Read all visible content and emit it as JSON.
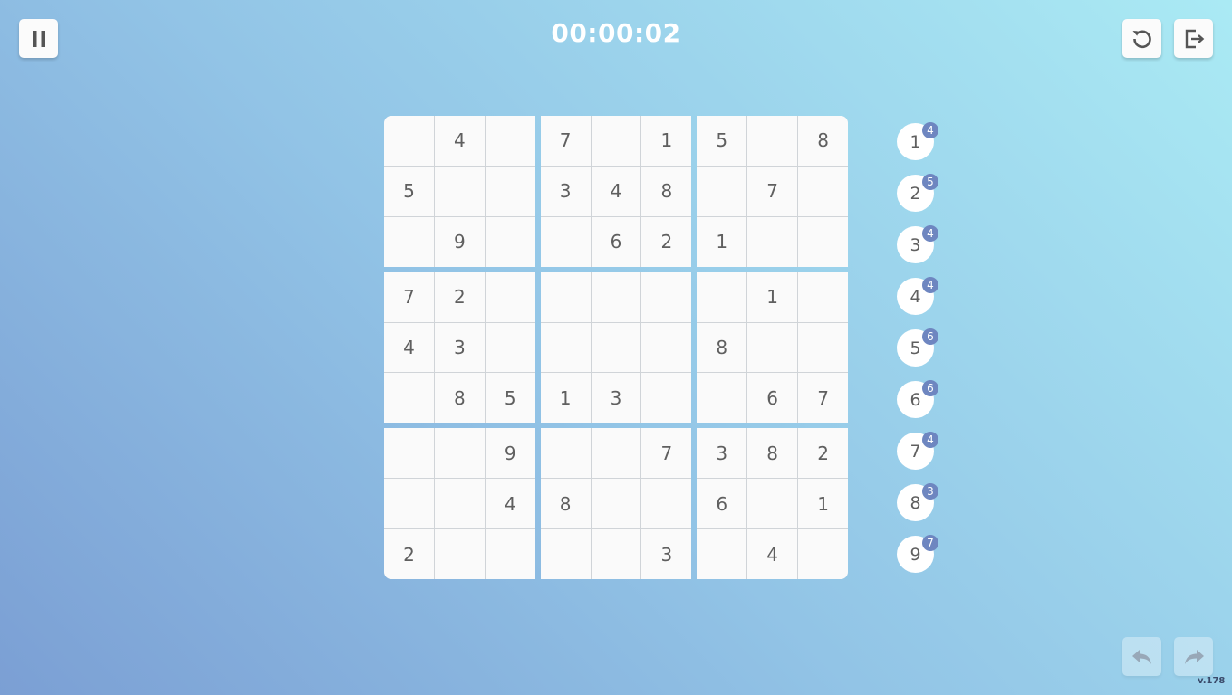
{
  "timer": "00:00:02",
  "toolbar": {
    "pause_icon": "pause-icon",
    "restart_icon": "restart-icon",
    "exit_icon": "exit-icon",
    "undo_icon": "undo-icon",
    "redo_icon": "redo-icon"
  },
  "board": [
    [
      "",
      "4",
      "",
      "7",
      "",
      "1",
      "5",
      "",
      "8"
    ],
    [
      "5",
      "",
      "",
      "3",
      "4",
      "8",
      "",
      "7",
      ""
    ],
    [
      "",
      "9",
      "",
      "",
      "6",
      "2",
      "1",
      "",
      ""
    ],
    [
      "7",
      "2",
      "",
      "",
      "",
      "",
      "",
      "1",
      ""
    ],
    [
      "4",
      "3",
      "",
      "",
      "",
      "",
      "8",
      "",
      ""
    ],
    [
      "",
      "8",
      "5",
      "1",
      "3",
      "",
      "",
      "6",
      "7"
    ],
    [
      "",
      "",
      "9",
      "",
      "",
      "7",
      "3",
      "8",
      "2"
    ],
    [
      "",
      "",
      "4",
      "8",
      "",
      "",
      "6",
      "",
      "1"
    ],
    [
      "2",
      "",
      "",
      "",
      "",
      "3",
      "",
      "4",
      ""
    ]
  ],
  "palette": [
    {
      "digit": "1",
      "remaining": "4"
    },
    {
      "digit": "2",
      "remaining": "5"
    },
    {
      "digit": "3",
      "remaining": "4"
    },
    {
      "digit": "4",
      "remaining": "4"
    },
    {
      "digit": "5",
      "remaining": "6"
    },
    {
      "digit": "6",
      "remaining": "6"
    },
    {
      "digit": "7",
      "remaining": "4"
    },
    {
      "digit": "8",
      "remaining": "3"
    },
    {
      "digit": "9",
      "remaining": "7"
    }
  ],
  "version": "v.178",
  "colors": {
    "badge": "#6e86c0",
    "cell_text": "#5f5f5f"
  }
}
